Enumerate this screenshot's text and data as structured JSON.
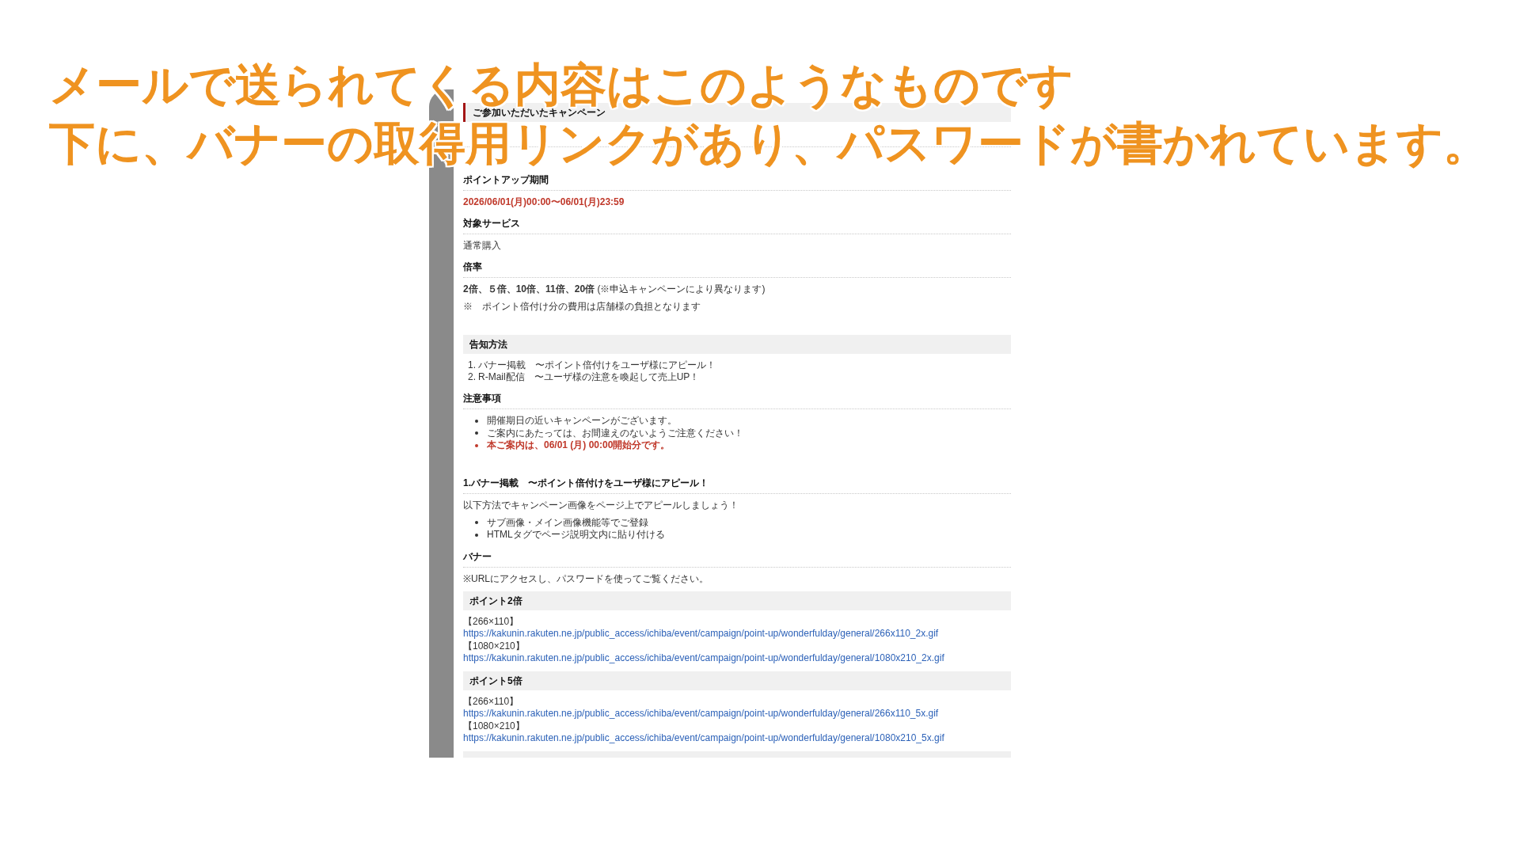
{
  "caption": {
    "lines": [
      "メールで送られてくる内容はこのようなものです",
      "下に、バナーの取得用リンクがあり、パスワードが書かれています。"
    ]
  },
  "email": {
    "sections": [
      {
        "blocks": [
          {
            "kind": "title_box",
            "text": "ご参加いただいたキャンペーン"
          },
          {
            "kind": "divider"
          },
          {
            "kind": "heading",
            "text": "ポイントアップ期間"
          },
          {
            "kind": "text",
            "text": "2026/06/01(月)00:00〜06/01(月)23:59",
            "highlight": true
          },
          {
            "kind": "heading",
            "text": "対象サービス"
          },
          {
            "kind": "text",
            "text": "通常購入",
            "highlight": false
          },
          {
            "kind": "heading",
            "text": "倍率"
          },
          {
            "kind": "text",
            "text": "**2倍、５倍、10倍、11倍、20倍** (※申込キャンペーンにより異なります)",
            "highlight": false
          },
          {
            "kind": "text",
            "text": "※　ポイント倍付け分の費用は店舗様の負担となります",
            "highlight": false
          }
        ]
      },
      {
        "blocks": [
          {
            "kind": "box_heading",
            "text": "告知方法"
          },
          {
            "kind": "numbered_list",
            "items": [
              {
                "number": "1.",
                "text": "バナー掲載　〜ポイント倍付けをユーザ様にアピール！"
              },
              {
                "number": "2.",
                "text": "R-Mail配信　〜ユーザ様の注意を喚起して売上UP！"
              }
            ]
          },
          {
            "kind": "heading",
            "text": "注意事項"
          },
          {
            "kind": "bullet_list",
            "items": [
              {
                "text": "開催期日の近いキャンペーンがございます。",
                "highlight": false
              },
              {
                "text": "ご案内にあたっては、お間違えのないようご注意ください！",
                "highlight": false
              },
              {
                "text": "本ご案内は、06/01 (月) 00:00開始分です。",
                "highlight": true
              }
            ]
          }
        ]
      },
      {
        "blocks": [
          {
            "kind": "heading",
            "text": "1.バナー掲載　〜ポイント倍付けをユーザ様にアピール！"
          },
          {
            "kind": "text",
            "text": "以下方法でキャンペーン画像をページ上でアピールしましょう！",
            "highlight": false
          },
          {
            "kind": "bullet_list",
            "items": [
              {
                "text": "サブ画像・メイン画像機能等でご登録",
                "highlight": false
              },
              {
                "text": "HTMLタグでページ説明文内に貼り付ける",
                "highlight": false
              }
            ]
          },
          {
            "kind": "heading",
            "text": "バナー"
          },
          {
            "kind": "text",
            "text": "※URLにアクセスし、パスワードを使ってご覧ください。",
            "highlight": false
          },
          {
            "kind": "box_heading",
            "text": "ポイント2倍"
          },
          {
            "kind": "banner_links",
            "items": [
              {
                "size": "【266×110】",
                "url": "https://kakunin.rakuten.ne.jp/public_access/ichiba/event/campaign/point-up/wonderfulday/general/266x110_2x.gif"
              },
              {
                "size": "【1080×210】",
                "url": "https://kakunin.rakuten.ne.jp/public_access/ichiba/event/campaign/point-up/wonderfulday/general/1080x210_2x.gif"
              }
            ]
          },
          {
            "kind": "box_heading",
            "text": "ポイント5倍"
          },
          {
            "kind": "banner_links",
            "items": [
              {
                "size": "【266×110】",
                "url": "https://kakunin.rakuten.ne.jp/public_access/ichiba/event/campaign/point-up/wonderfulday/general/266x110_5x.gif"
              },
              {
                "size": "【1080×210】",
                "url": "https://kakunin.rakuten.ne.jp/public_access/ichiba/event/campaign/point-up/wonderfulday/general/1080x210_5x.gif"
              }
            ]
          },
          {
            "kind": "box_edge"
          }
        ]
      }
    ]
  }
}
